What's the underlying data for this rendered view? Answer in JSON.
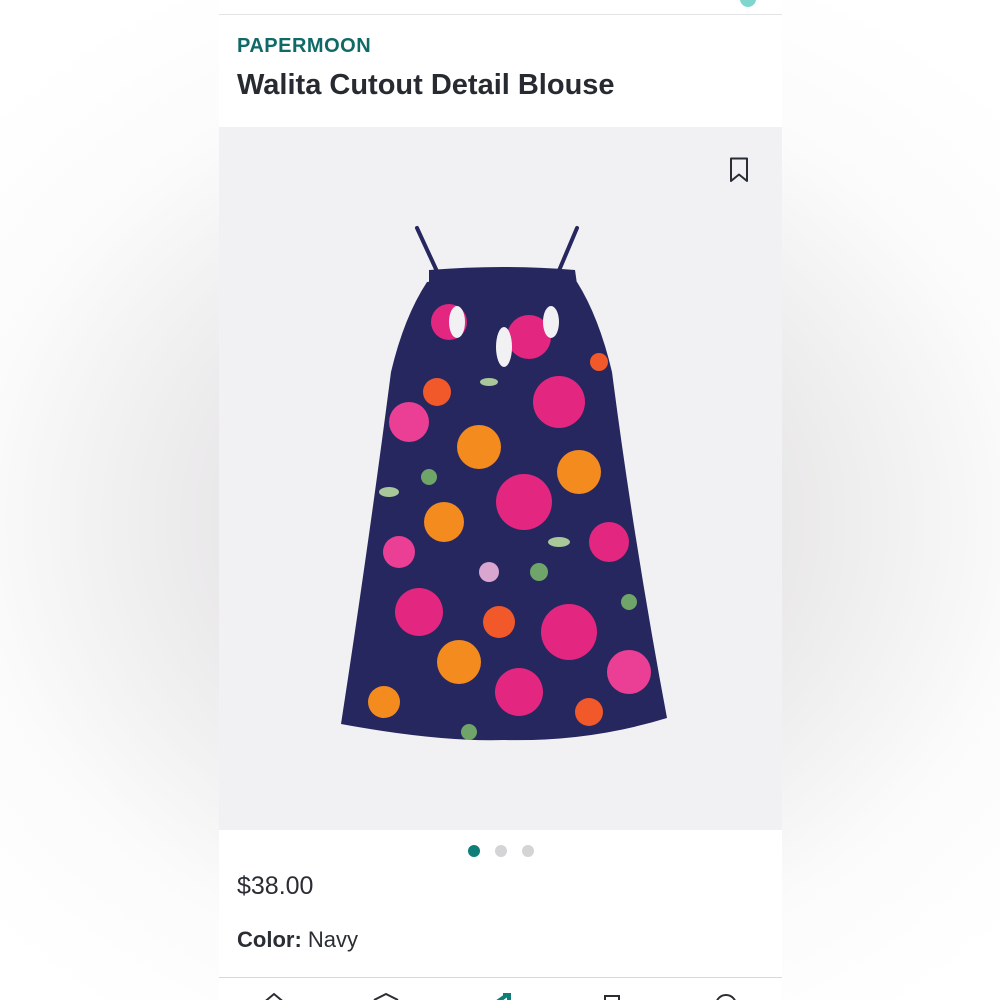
{
  "product": {
    "brand": "PAPERMOON",
    "title": "Walita Cutout Detail Blouse",
    "price": "$38.00",
    "color_label": "Color:",
    "color_value": "Navy"
  },
  "gallery": {
    "image_icon": "floral-halter-blouse-photo",
    "bookmark_icon": "bookmark-icon",
    "page_count": 3,
    "active_page": 1
  },
  "tabbar": {
    "icons": [
      "home-icon",
      "box-icon",
      "stitch-fix-icon",
      "bookmark-icon",
      "account-icon"
    ]
  },
  "colors": {
    "brand_teal": "#0f6a67",
    "active_dot": "#0f7d78",
    "navy": "#27275f"
  }
}
